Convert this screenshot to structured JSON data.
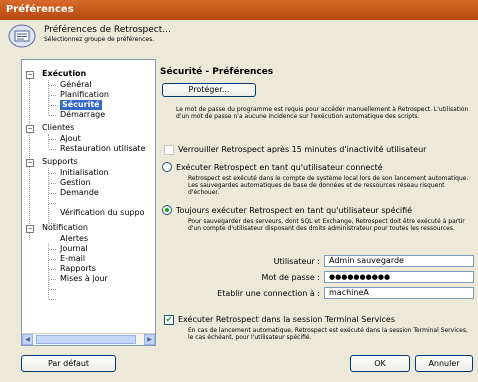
{
  "window": {
    "title": "Préférences"
  },
  "header": {
    "title": "Préférences de Retrospect...",
    "subtitle": "Sélectionnez groupe de préférences."
  },
  "tree": {
    "items": [
      {
        "label": "Exécution"
      },
      {
        "label": "Général"
      },
      {
        "label": "Planification"
      },
      {
        "label": "Sécurité"
      },
      {
        "label": "Démarrage"
      },
      {
        "label": "Clientes"
      },
      {
        "label": "Ajout"
      },
      {
        "label": "Restauration utilisate"
      },
      {
        "label": "Supports"
      },
      {
        "label": "Initialisation"
      },
      {
        "label": "Gestion"
      },
      {
        "label": "Demande"
      },
      {
        "label": "Vérification du suppo"
      },
      {
        "label": "Notification"
      },
      {
        "label": "Alertes"
      },
      {
        "label": "Journal"
      },
      {
        "label": "E-mail"
      },
      {
        "label": "Rapports"
      },
      {
        "label": "Mises à jour"
      }
    ]
  },
  "security": {
    "title": "Sécurité - Préférences",
    "protect_button": "Protéger...",
    "protect_desc": "Le mot de passe du programme est requis pour accéder manuellement à Retrospect. L'utilisation d'un mot de passe n'a aucune incidence sur l'exécution automatique des scripts.",
    "lock_label": "Verrouiller Retrospect après 15 minutes d'inactivité utilisateur",
    "run_connected_label": "Exécuter Retrospect en tant qu'utilisateur connecté",
    "run_connected_desc": "Retrospect est exécuté dans le compte de système local lors de son lancement automatique. Les sauvegardes automatiques de base de données et de ressources réseau risquent d'échouer.",
    "run_always_label": "Toujours exécuter Retrospect en tant qu'utilisateur spécifié",
    "run_always_desc": "Pour sauvegarder des serveurs, dont SQL et Exchange, Retrospect doit être exécuté à partir d'un compte d'utilisateur disposant des droits administrateur pour toutes les ressources.",
    "user_label": "Utilisateur :",
    "user_value": "Admin sauvegarde",
    "password_label": "Mot de passe :",
    "password_value": "●●●●●●●●●●",
    "connection_label": "Etablir une connection à :",
    "connection_value": "machineA",
    "terminal_label": "Exécuter Retrospect dans la session Terminal Services",
    "terminal_desc": "En cas de lancement automatique, Retrospect est exécuté dans la session Terminal Services, le cas échéant, pour l'utilisateur spécifié."
  },
  "footer": {
    "default_button": "Par défaut",
    "ok_button": "OK",
    "cancel_button": "Annuler"
  },
  "colors": {
    "title_bar": "#c5561a",
    "selection": "#316ac5",
    "window_bg": "#ece9d8"
  }
}
